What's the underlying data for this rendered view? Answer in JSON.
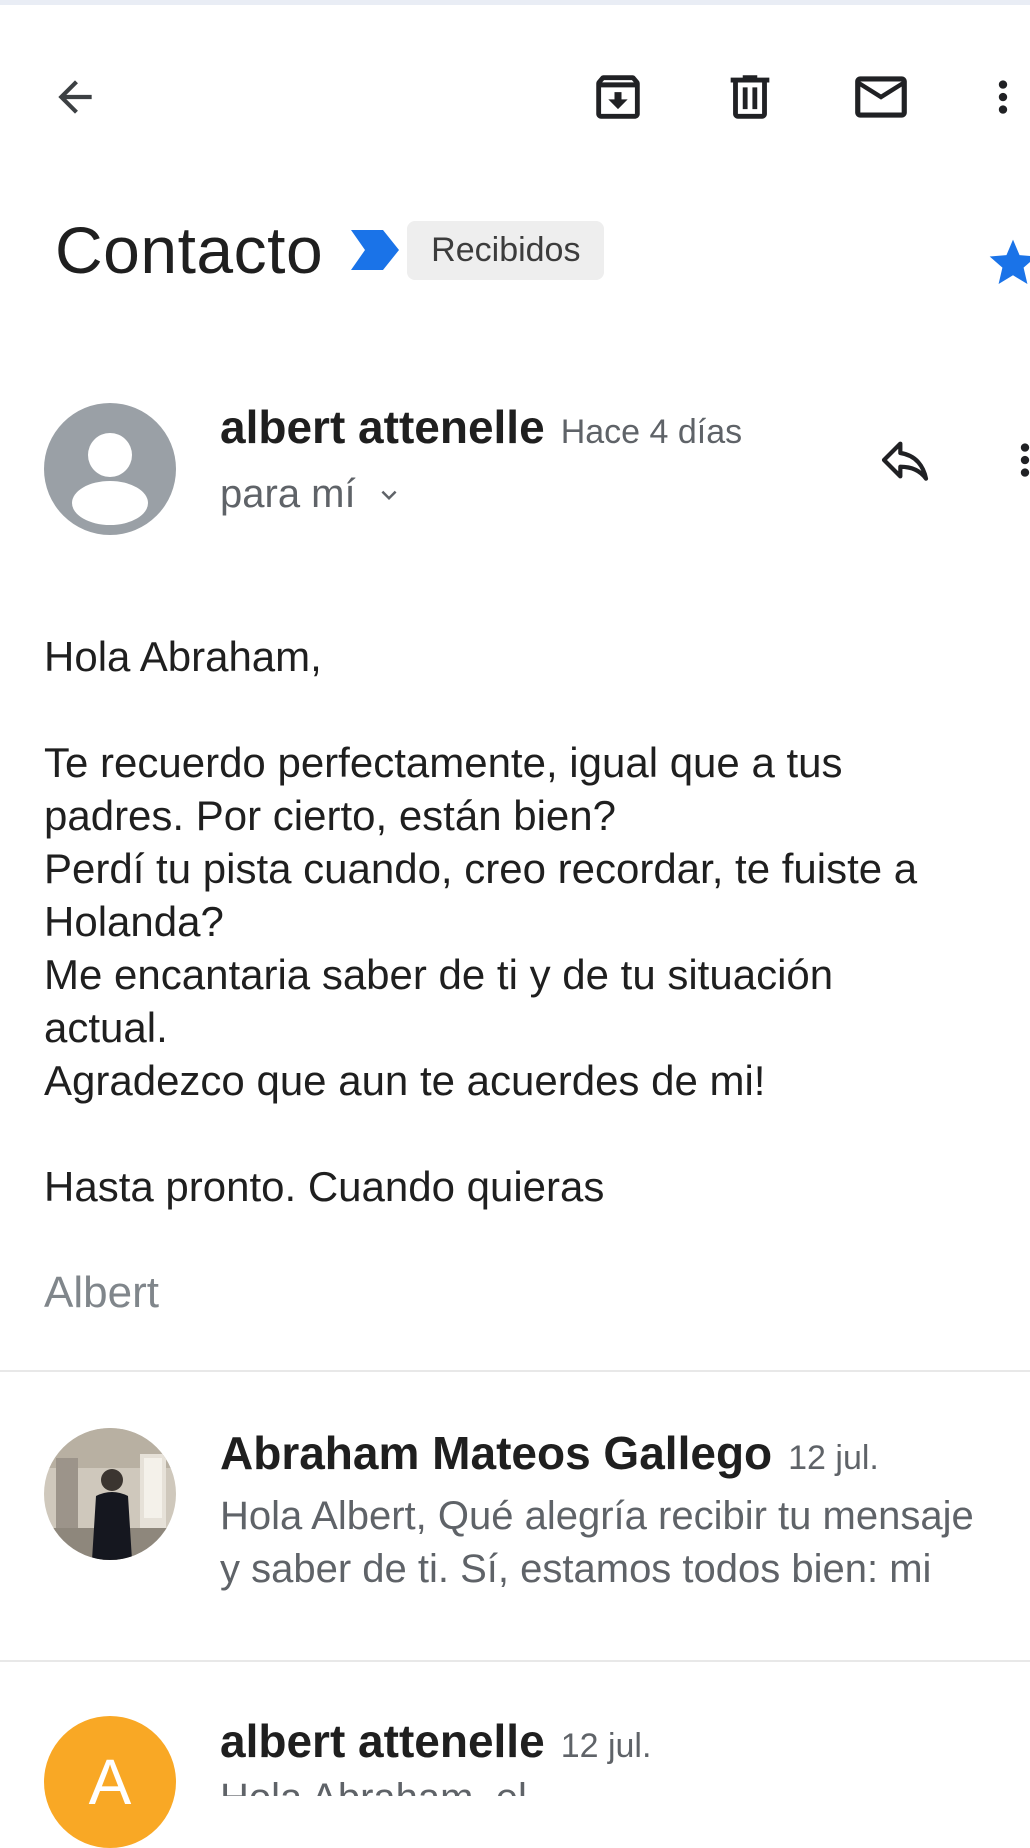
{
  "toolbar": {
    "back_icon": "arrow-left-icon",
    "archive_icon": "archive-icon",
    "delete_icon": "trash-icon",
    "mark_unread_icon": "mail-icon",
    "more_icon": "more-vertical-icon"
  },
  "subject": {
    "title": "Contacto",
    "importance_icon": "importance-marker-icon",
    "label": "Recibidos",
    "star_icon": "star-icon",
    "star_color": "#1a73e8"
  },
  "message": {
    "sender": "albert attenelle",
    "date": "Hace 4 días",
    "recipient": "para mí",
    "body": {
      "greeting": "Hola Abraham,",
      "lines": [
        "Te recuerdo perfectamente, igual que a tus",
        "padres. Por cierto, están bien?",
        "Perdí tu pista cuando, creo recordar, te fuiste a",
        "Holanda?",
        "Me encantaria saber de ti y de tu situación",
        "actual.",
        "Agradezco que aun te acuerdes de mi!"
      ],
      "closing": "Hasta pronto. Cuando quieras"
    },
    "signature": "Albert"
  },
  "thread": [
    {
      "sender": "Abraham Mateos Gallego",
      "date": "12 jul.",
      "snippet_lines": [
        "Hola Albert, Qué alegría recibir tu mensaje",
        "y saber de ti. Sí, estamos todos bien: mi"
      ]
    },
    {
      "sender": "albert attenelle",
      "date": "12 jul.",
      "avatar_letter": "A",
      "avatar_color": "#f9a825",
      "snippet": "Hola Abraham, el"
    }
  ],
  "colors": {
    "accent": "#1a73e8",
    "avatar_grey": "#9aa0a6"
  }
}
